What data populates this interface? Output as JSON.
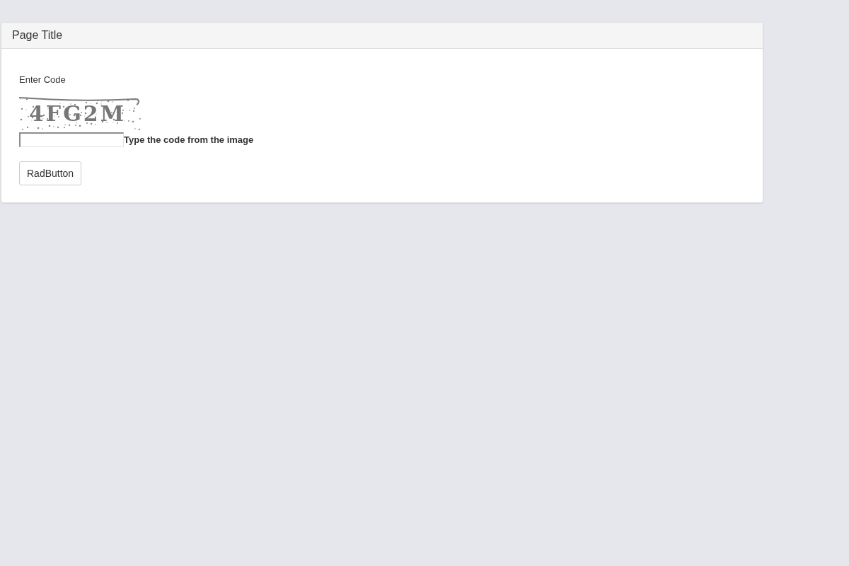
{
  "panel": {
    "title": "Page Title",
    "form": {
      "label": "Enter Code",
      "captcha_code": "4FG2M",
      "hint": "Type the code from the image",
      "button": "RadButton"
    }
  }
}
